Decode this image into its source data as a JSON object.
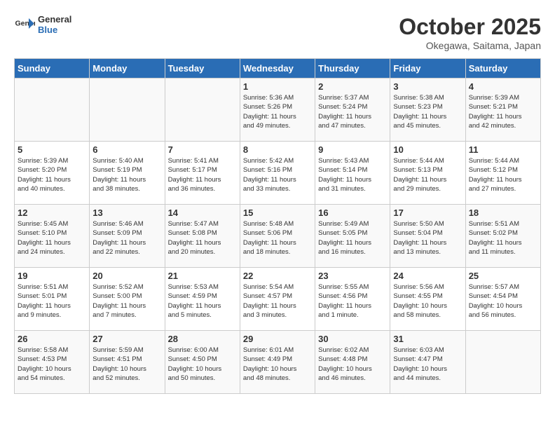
{
  "header": {
    "logo_line1": "General",
    "logo_line2": "Blue",
    "month": "October 2025",
    "location": "Okegawa, Saitama, Japan"
  },
  "days_of_week": [
    "Sunday",
    "Monday",
    "Tuesday",
    "Wednesday",
    "Thursday",
    "Friday",
    "Saturday"
  ],
  "weeks": [
    [
      {
        "day": "",
        "info": ""
      },
      {
        "day": "",
        "info": ""
      },
      {
        "day": "",
        "info": ""
      },
      {
        "day": "1",
        "info": "Sunrise: 5:36 AM\nSunset: 5:26 PM\nDaylight: 11 hours\nand 49 minutes."
      },
      {
        "day": "2",
        "info": "Sunrise: 5:37 AM\nSunset: 5:24 PM\nDaylight: 11 hours\nand 47 minutes."
      },
      {
        "day": "3",
        "info": "Sunrise: 5:38 AM\nSunset: 5:23 PM\nDaylight: 11 hours\nand 45 minutes."
      },
      {
        "day": "4",
        "info": "Sunrise: 5:39 AM\nSunset: 5:21 PM\nDaylight: 11 hours\nand 42 minutes."
      }
    ],
    [
      {
        "day": "5",
        "info": "Sunrise: 5:39 AM\nSunset: 5:20 PM\nDaylight: 11 hours\nand 40 minutes."
      },
      {
        "day": "6",
        "info": "Sunrise: 5:40 AM\nSunset: 5:19 PM\nDaylight: 11 hours\nand 38 minutes."
      },
      {
        "day": "7",
        "info": "Sunrise: 5:41 AM\nSunset: 5:17 PM\nDaylight: 11 hours\nand 36 minutes."
      },
      {
        "day": "8",
        "info": "Sunrise: 5:42 AM\nSunset: 5:16 PM\nDaylight: 11 hours\nand 33 minutes."
      },
      {
        "day": "9",
        "info": "Sunrise: 5:43 AM\nSunset: 5:14 PM\nDaylight: 11 hours\nand 31 minutes."
      },
      {
        "day": "10",
        "info": "Sunrise: 5:44 AM\nSunset: 5:13 PM\nDaylight: 11 hours\nand 29 minutes."
      },
      {
        "day": "11",
        "info": "Sunrise: 5:44 AM\nSunset: 5:12 PM\nDaylight: 11 hours\nand 27 minutes."
      }
    ],
    [
      {
        "day": "12",
        "info": "Sunrise: 5:45 AM\nSunset: 5:10 PM\nDaylight: 11 hours\nand 24 minutes."
      },
      {
        "day": "13",
        "info": "Sunrise: 5:46 AM\nSunset: 5:09 PM\nDaylight: 11 hours\nand 22 minutes."
      },
      {
        "day": "14",
        "info": "Sunrise: 5:47 AM\nSunset: 5:08 PM\nDaylight: 11 hours\nand 20 minutes."
      },
      {
        "day": "15",
        "info": "Sunrise: 5:48 AM\nSunset: 5:06 PM\nDaylight: 11 hours\nand 18 minutes."
      },
      {
        "day": "16",
        "info": "Sunrise: 5:49 AM\nSunset: 5:05 PM\nDaylight: 11 hours\nand 16 minutes."
      },
      {
        "day": "17",
        "info": "Sunrise: 5:50 AM\nSunset: 5:04 PM\nDaylight: 11 hours\nand 13 minutes."
      },
      {
        "day": "18",
        "info": "Sunrise: 5:51 AM\nSunset: 5:02 PM\nDaylight: 11 hours\nand 11 minutes."
      }
    ],
    [
      {
        "day": "19",
        "info": "Sunrise: 5:51 AM\nSunset: 5:01 PM\nDaylight: 11 hours\nand 9 minutes."
      },
      {
        "day": "20",
        "info": "Sunrise: 5:52 AM\nSunset: 5:00 PM\nDaylight: 11 hours\nand 7 minutes."
      },
      {
        "day": "21",
        "info": "Sunrise: 5:53 AM\nSunset: 4:59 PM\nDaylight: 11 hours\nand 5 minutes."
      },
      {
        "day": "22",
        "info": "Sunrise: 5:54 AM\nSunset: 4:57 PM\nDaylight: 11 hours\nand 3 minutes."
      },
      {
        "day": "23",
        "info": "Sunrise: 5:55 AM\nSunset: 4:56 PM\nDaylight: 11 hours\nand 1 minute."
      },
      {
        "day": "24",
        "info": "Sunrise: 5:56 AM\nSunset: 4:55 PM\nDaylight: 10 hours\nand 58 minutes."
      },
      {
        "day": "25",
        "info": "Sunrise: 5:57 AM\nSunset: 4:54 PM\nDaylight: 10 hours\nand 56 minutes."
      }
    ],
    [
      {
        "day": "26",
        "info": "Sunrise: 5:58 AM\nSunset: 4:53 PM\nDaylight: 10 hours\nand 54 minutes."
      },
      {
        "day": "27",
        "info": "Sunrise: 5:59 AM\nSunset: 4:51 PM\nDaylight: 10 hours\nand 52 minutes."
      },
      {
        "day": "28",
        "info": "Sunrise: 6:00 AM\nSunset: 4:50 PM\nDaylight: 10 hours\nand 50 minutes."
      },
      {
        "day": "29",
        "info": "Sunrise: 6:01 AM\nSunset: 4:49 PM\nDaylight: 10 hours\nand 48 minutes."
      },
      {
        "day": "30",
        "info": "Sunrise: 6:02 AM\nSunset: 4:48 PM\nDaylight: 10 hours\nand 46 minutes."
      },
      {
        "day": "31",
        "info": "Sunrise: 6:03 AM\nSunset: 4:47 PM\nDaylight: 10 hours\nand 44 minutes."
      },
      {
        "day": "",
        "info": ""
      }
    ]
  ]
}
